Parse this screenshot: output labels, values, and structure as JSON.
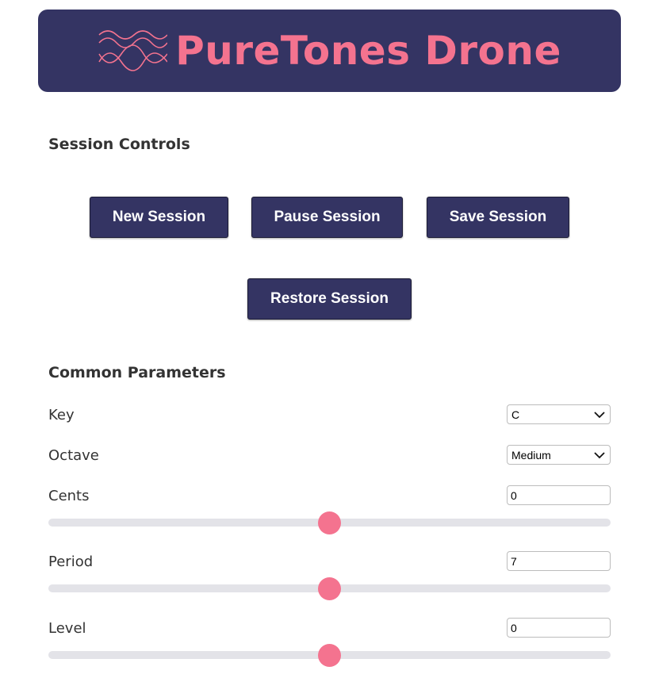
{
  "app": {
    "title": "PureTones Drone",
    "accent_color": "#f4738f",
    "header_color": "#343463",
    "logo_icon": "sine-waves-icon"
  },
  "session_controls": {
    "heading": "Session Controls",
    "buttons": {
      "new": "New Session",
      "pause": "Pause Session",
      "save": "Save Session",
      "restore": "Restore Session"
    }
  },
  "common_parameters": {
    "heading": "Common Parameters",
    "key": {
      "label": "Key",
      "value": "C"
    },
    "octave": {
      "label": "Octave",
      "value": "Medium"
    },
    "cents": {
      "label": "Cents",
      "value": "0",
      "slider_fraction": 0.5
    },
    "period": {
      "label": "Period",
      "value": "7",
      "slider_fraction": 0.5
    },
    "level": {
      "label": "Level",
      "value": "0",
      "slider_fraction": 0.5
    }
  }
}
